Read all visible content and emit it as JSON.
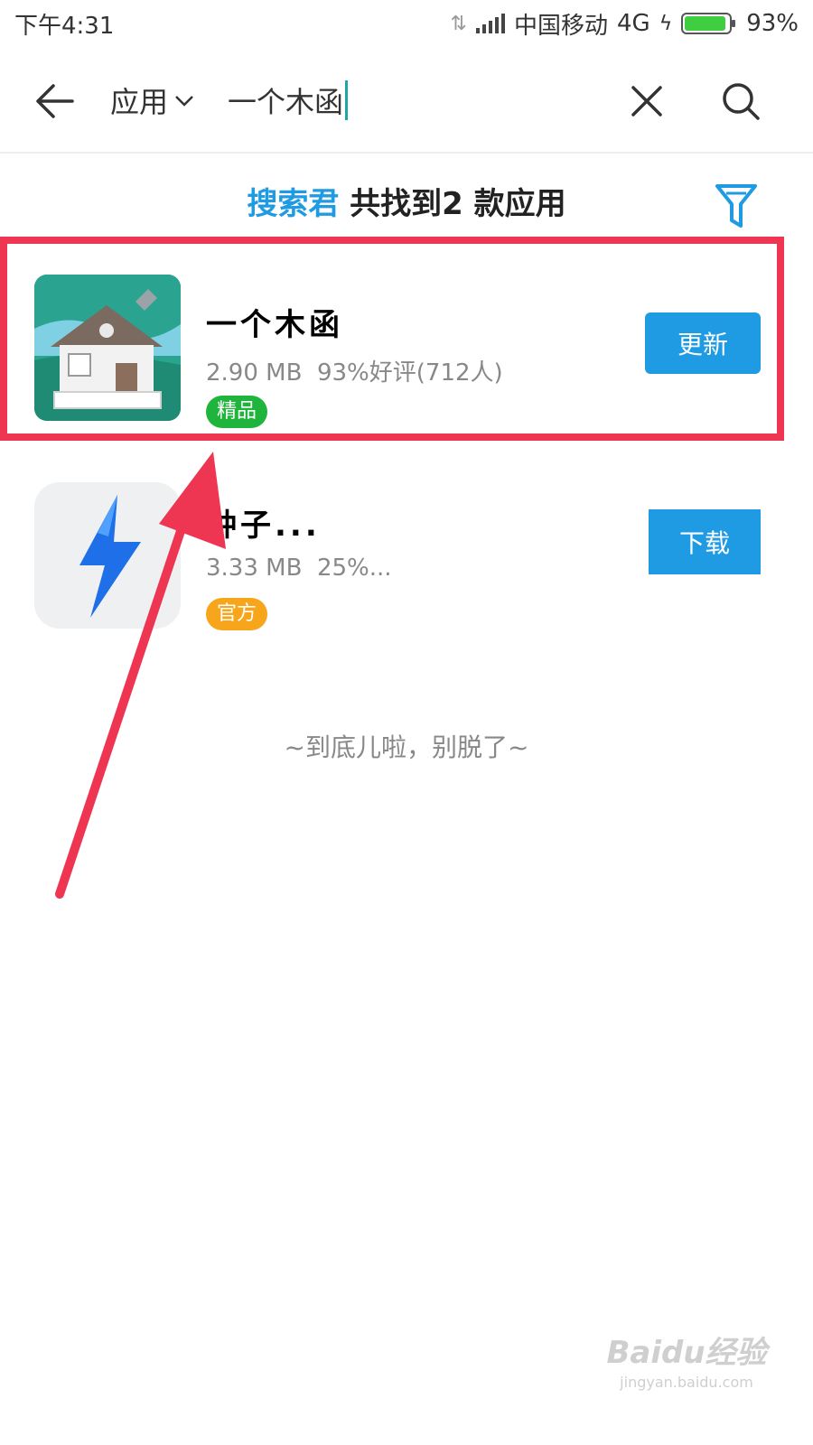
{
  "status_bar": {
    "time": "下午4:31",
    "carrier": "中国移动",
    "network": "4G",
    "battery_percent": "93%",
    "battery_level": 0.93
  },
  "search": {
    "category": "应用",
    "query": "一个木函"
  },
  "result_header": {
    "brand": "搜索君",
    "summary": "共找到2 款应用"
  },
  "apps": [
    {
      "name": "一个木函",
      "size": "2.90 MB",
      "rating": "93%好评(712人)",
      "tag": "精品",
      "action": "更新"
    },
    {
      "name": "种子...",
      "size": "3.33 MB",
      "rating": "25%...",
      "tag": "官方",
      "action": "下载"
    }
  ],
  "end_message": "~到底儿啦，别脱了~",
  "watermark": {
    "brand": "Baidu经验",
    "url": "jingyan.baidu.com"
  },
  "colors": {
    "accent": "#1e9be3",
    "highlight": "#ee3552",
    "tag_green": "#1fb53c",
    "tag_orange": "#f7a61c"
  }
}
